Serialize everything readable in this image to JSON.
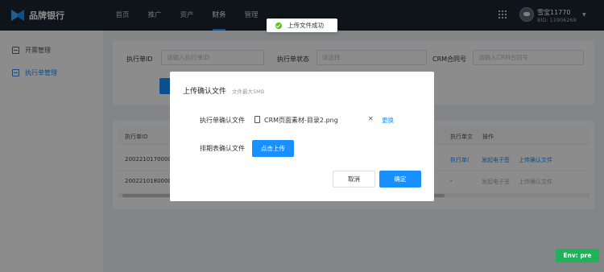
{
  "header": {
    "brand": "品牌银行",
    "nav": [
      "首页",
      "推广",
      "资产",
      "财务",
      "管理"
    ],
    "user_name": "雪宝11770",
    "user_bid": "BID: 11906268"
  },
  "sidebar": {
    "items": [
      {
        "label": "开票管理"
      },
      {
        "label": "执行单管理"
      }
    ]
  },
  "filters": {
    "exec_id_label": "执行单ID",
    "exec_id_placeholder": "请输入执行单ID",
    "status_label": "执行单状态",
    "status_placeholder": "请选择",
    "crm_label": "CRM合同号",
    "crm_placeholder": "请输入CRM合同号"
  },
  "table": {
    "headers": [
      "执行单ID",
      "执行单文",
      "操作"
    ],
    "rows": [
      {
        "id": "2002210170000",
        "file": "执行单(",
        "actions": [
          "发起电子签",
          "上传确认文件"
        ]
      },
      {
        "id": "2002210180000",
        "file": "-",
        "actions": [
          "发起电子签",
          "上传确认文件"
        ]
      }
    ]
  },
  "toast": {
    "text": "上传文件成功"
  },
  "modal": {
    "title": "上传确认文件",
    "subtitle": "文件最大5MB",
    "exec_file_label": "执行单确认文件",
    "file_name": "CRM页面素材-目录2.png",
    "change_label": "更换",
    "schedule_label": "排期表确认文件",
    "upload_label": "点击上传",
    "cancel_label": "取消",
    "confirm_label": "确定"
  },
  "env": {
    "label": "Env: pre"
  },
  "colors": {
    "primary": "#1890ff",
    "topbar": "#1c2531",
    "success": "#52c41a",
    "env": "#1fb25a"
  }
}
